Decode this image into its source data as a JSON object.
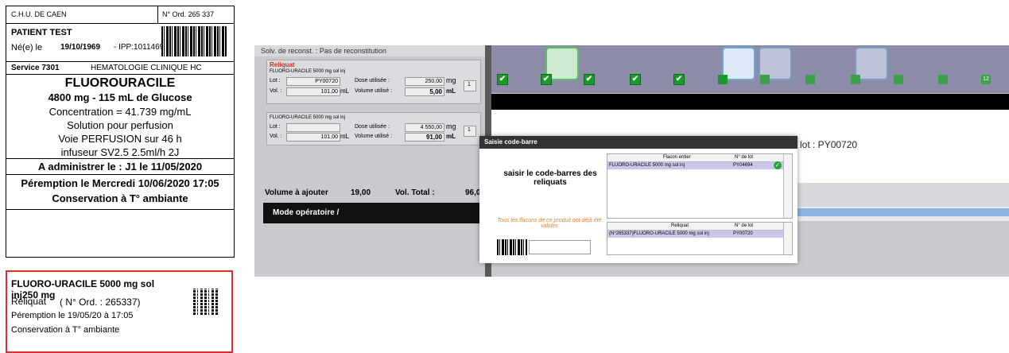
{
  "label": {
    "hospital": "C.H.U. DE CAEN",
    "ord_no": "N° Ord. 265 337",
    "patient": "PATIENT TEST",
    "dob_label": "Né(e) le",
    "dob": "19/10/1969",
    "ipp": "- IPP:1011469",
    "service": "Service 7301",
    "service_name": "HEMATOLOGIE CLINIQUE HC",
    "drug": "FLUOROURACILE",
    "dose_line": "4800 mg - 115 mL de  Glucose",
    "concentration": "Concentration = 41.739 mg/mL",
    "solution": "Solution pour perfusion",
    "route": "Voie PERFUSION sur 46 h",
    "device": "infuseur SV2.5 2.5ml/h 2J",
    "administer": "A administrer le : J1 le 11/05/2020",
    "expiry": "Péremption le Mercredi 10/06/2020 17:05",
    "storage": "Conservation  à T° ambiante"
  },
  "reliquat_card": {
    "title_line1": "FLUORO-URACILE 5000 mg sol",
    "title_line2": "inj250 mg",
    "reliquat": "Reliquat",
    "ord": "( N° Ord. : 265337)",
    "expiry": "Péremption le 19/05/20 à 17:05",
    "storage": "Conservation   à T° ambiante"
  },
  "app": {
    "solv": "Solv. de reconst. :   Pas de reconstitution",
    "reliquat_title": "Reliquat",
    "product1": "FLUORO-URACILE 5000 mg sol inj",
    "lot_label": "Lot :",
    "lot1": "PY00720",
    "dose_used_label": "Dose utilisée :",
    "dose1": "250,00",
    "mg": "mg",
    "qty1": "1",
    "vol_label": "Vol. :",
    "vol1": "101,00",
    "ml": "mL",
    "vol_used_label": "Volume utilisé :",
    "vol_used1": "5,00",
    "product2": "FLUORO-URACILE 5000 mg sol inj",
    "dose2": "4 550,00",
    "qty2": "1",
    "vol2": "101,00",
    "vol_used2": "91,00",
    "vol_add_label": "Volume à ajouter",
    "vol_add": "19,00",
    "vol_total_label": "Vol. Total :",
    "vol_total": "96,00",
    "mode": "Mode opératoire /",
    "lot_info": "e lot : PY00720",
    "step12": "12"
  },
  "modal": {
    "title": "Saisie code-barre",
    "prompt": "saisir le code-barres des reliquats",
    "warning": "Tous les flacons de ce produit ont déjà été validés",
    "t1_col1": "Flacon entier",
    "t1_col2": "N° de lot",
    "t1_r1c1": "FLUORO-URACILE 5000 mg sol inj",
    "t1_r1c2": "PY04694",
    "t2_col1": "Reliquat",
    "t2_col2": "N° de lot",
    "t2_r1c1": "(N°265337)FLUORO-URACILE 5000 mg sol inj",
    "t2_r1c2": "PY00720"
  },
  "colors": {
    "accent_green": "#1a9a2a",
    "card_border": "#e0302a",
    "selected_row": "#c9c8ea"
  }
}
